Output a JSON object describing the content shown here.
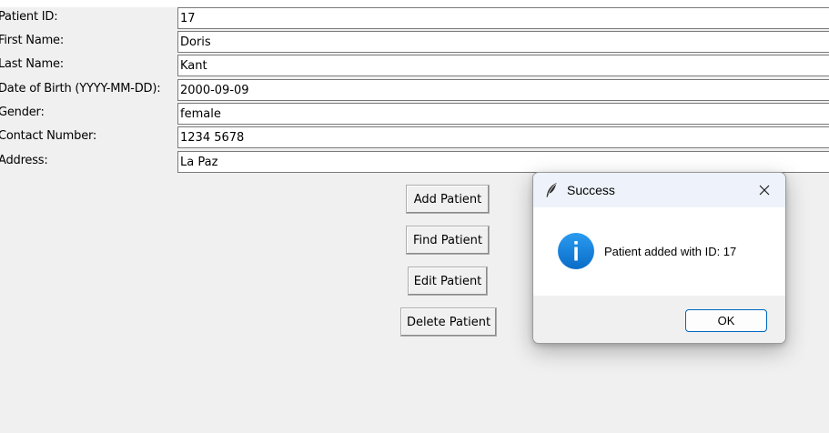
{
  "form": {
    "fields": [
      {
        "label": "Patient ID:",
        "value": "17"
      },
      {
        "label": "First Name:",
        "value": "Doris"
      },
      {
        "label": "Last Name:",
        "value": "Kant"
      },
      {
        "label": "Date of Birth (YYYY-MM-DD):",
        "value": "2000-09-09"
      },
      {
        "label": "Gender:",
        "value": "female"
      },
      {
        "label": "Contact Number:",
        "value": "1234 5678"
      },
      {
        "label": "Address:",
        "value": "La Paz"
      }
    ]
  },
  "actions": {
    "add": "Add Patient",
    "find": "Find Patient",
    "edit": "Edit Patient",
    "delete": "Delete Patient"
  },
  "dialog": {
    "title": "Success",
    "message": "Patient added with ID: 17",
    "ok_label": "OK",
    "title_icon": "feather-icon",
    "body_icon": "info-icon",
    "close_icon": "close-icon",
    "accent_color": "#0067c0"
  }
}
